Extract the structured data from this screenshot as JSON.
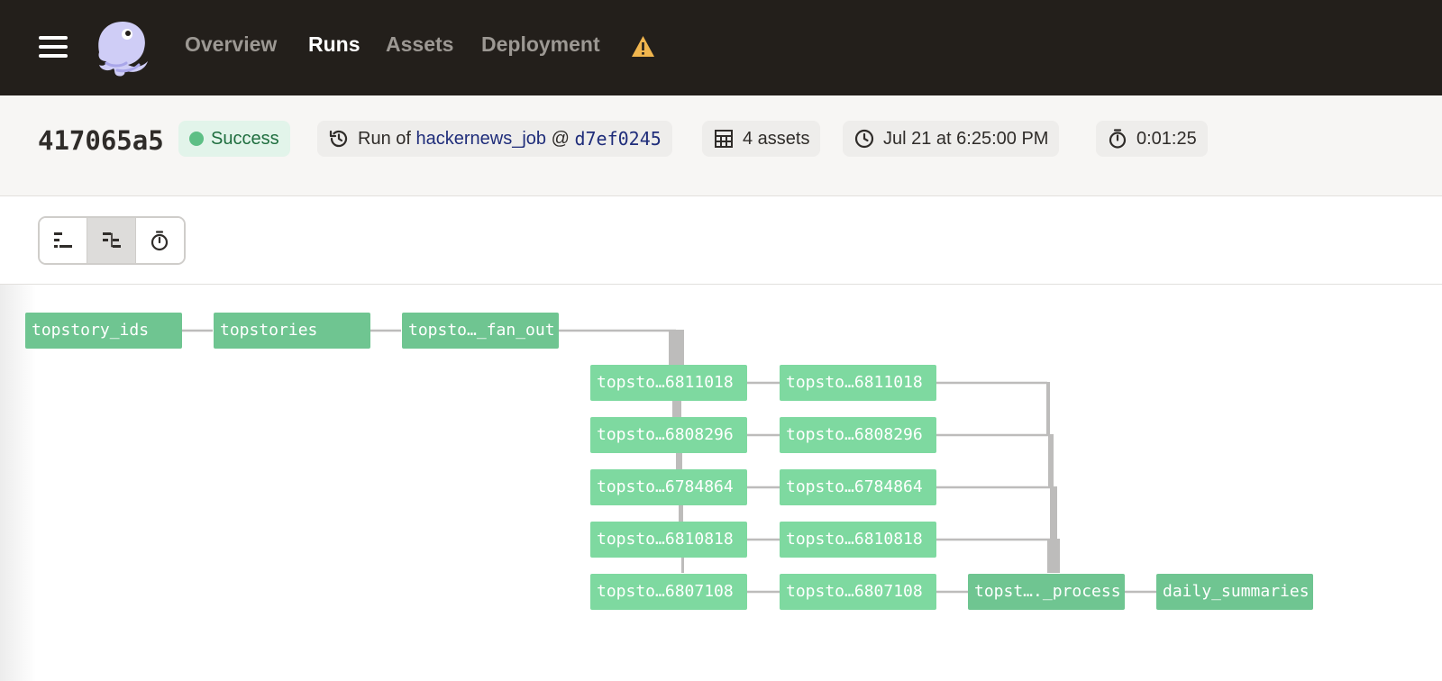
{
  "nav": {
    "links": [
      "Overview",
      "Runs",
      "Assets",
      "Deployment"
    ],
    "active": "Runs"
  },
  "header": {
    "run_id": "417065a5",
    "status": "Success",
    "run_of_prefix": "Run of",
    "job_name": "hackernews_job",
    "at_symbol": "@",
    "snapshot_id": "d7ef0245",
    "assets": "4 assets",
    "timestamp": "Jul 21 at 6:25:00 PM",
    "duration": "0:01:25"
  },
  "colors": {
    "nav_bg": "#231f1b",
    "success": "#5dbf85",
    "node_dark": "#6fc591",
    "node_light": "#7ed9a0",
    "warning": "#f0b54e"
  },
  "toolbar": {
    "buttons": [
      "flat-view-icon",
      "tree-view-icon",
      "timer-icon"
    ],
    "selected": 1
  },
  "graph": {
    "nodes": [
      "topstory_ids",
      "topstories",
      "topsto…_fan_out",
      "topsto…6811018",
      "topsto…6808296",
      "topsto…6784864",
      "topsto…6810818",
      "topsto…6807108",
      "topsto…6811018",
      "topsto…6808296",
      "topsto…6784864",
      "topsto…6810818",
      "topsto…6807108",
      "topst…._process",
      "daily_summaries"
    ]
  }
}
